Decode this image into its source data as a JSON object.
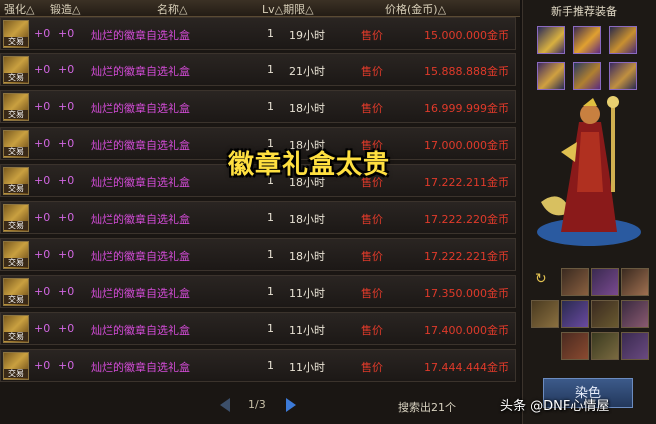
{
  "header": {
    "col_enhance": "强化△",
    "col_forge": "锻造△",
    "col_name": "名称△",
    "col_lv_expire": "Lv△期限△",
    "col_price": "价格(金币)△"
  },
  "rows": [
    {
      "badge": "交易",
      "enhance": "+0",
      "forge": "+0",
      "name": "灿烂的徽章自选礼盒",
      "lv": "1",
      "time": "19小时",
      "sell": "售价",
      "price": "15.000.000金币"
    },
    {
      "badge": "交易",
      "enhance": "+0",
      "forge": "+0",
      "name": "灿烂的徽章自选礼盒",
      "lv": "1",
      "time": "21小时",
      "sell": "售价",
      "price": "15.888.888金币"
    },
    {
      "badge": "交易",
      "enhance": "+0",
      "forge": "+0",
      "name": "灿烂的徽章自选礼盒",
      "lv": "1",
      "time": "18小时",
      "sell": "售价",
      "price": "16.999.999金币"
    },
    {
      "badge": "交易",
      "enhance": "+0",
      "forge": "+0",
      "name": "灿烂的徽章自选礼盒",
      "lv": "1",
      "time": "18小时",
      "sell": "售价",
      "price": "17.000.000金币"
    },
    {
      "badge": "交易",
      "enhance": "+0",
      "forge": "+0",
      "name": "灿烂的徽章自选礼盒",
      "lv": "1",
      "time": "18小时",
      "sell": "售价",
      "price": "17.222.211金币"
    },
    {
      "badge": "交易",
      "enhance": "+0",
      "forge": "+0",
      "name": "灿烂的徽章自选礼盒",
      "lv": "1",
      "time": "18小时",
      "sell": "售价",
      "price": "17.222.220金币"
    },
    {
      "badge": "交易",
      "enhance": "+0",
      "forge": "+0",
      "name": "灿烂的徽章自选礼盒",
      "lv": "1",
      "time": "18小时",
      "sell": "售价",
      "price": "17.222.221金币"
    },
    {
      "badge": "交易",
      "enhance": "+0",
      "forge": "+0",
      "name": "灿烂的徽章自选礼盒",
      "lv": "1",
      "time": "11小时",
      "sell": "售价",
      "price": "17.350.000金币"
    },
    {
      "badge": "交易",
      "enhance": "+0",
      "forge": "+0",
      "name": "灿烂的徽章自选礼盒",
      "lv": "1",
      "time": "11小时",
      "sell": "售价",
      "price": "17.400.000金币"
    },
    {
      "badge": "交易",
      "enhance": "+0",
      "forge": "+0",
      "name": "灿烂的徽章自选礼盒",
      "lv": "1",
      "time": "11小时",
      "sell": "售价",
      "price": "17.444.444金币"
    }
  ],
  "pager": {
    "text": "1/3"
  },
  "result_count": "搜索出21个",
  "overlay_text": "徽章礼盒太贵",
  "sidebar": {
    "title": "新手推荐装备",
    "button_label": "染色"
  },
  "watermark": "头条 @DNF心情屋",
  "colors": {
    "name": "#d44cd8",
    "price": "#e03a2a",
    "overlay": "#ffe040"
  }
}
